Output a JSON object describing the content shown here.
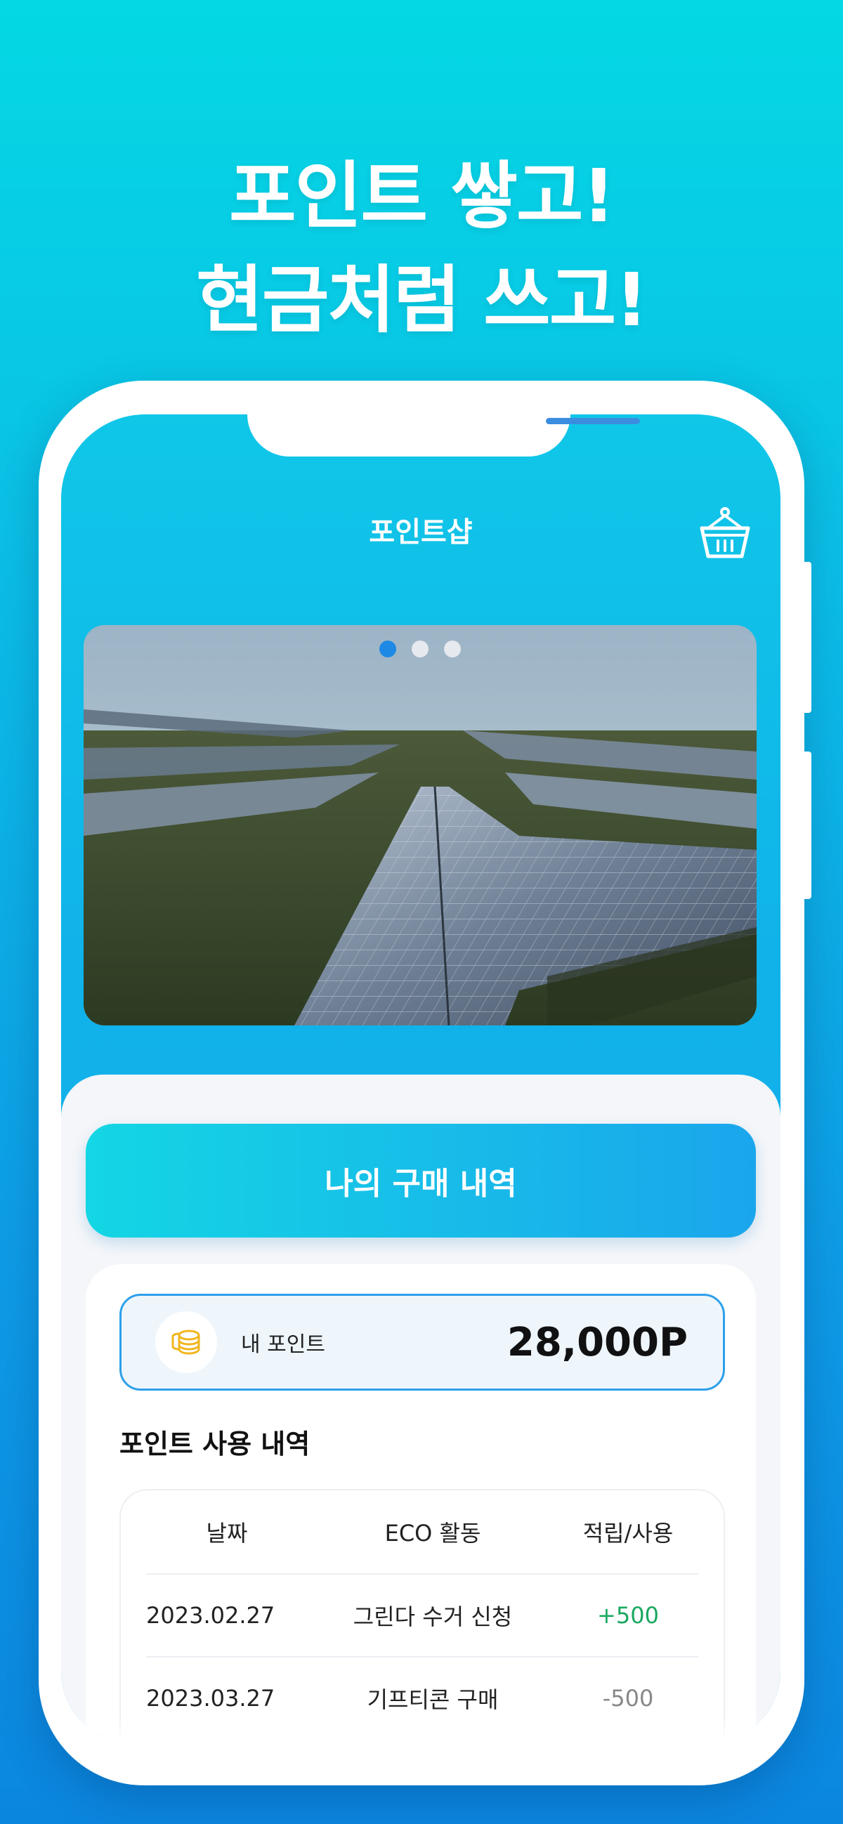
{
  "headline": {
    "line1": "포인트 쌓고!",
    "line2": "현금처럼 쓰고!"
  },
  "screen": {
    "title": "포인트샵",
    "cart_icon": "basket-icon"
  },
  "banner": {
    "slide_count": 3,
    "active_slide": 1,
    "image_subject": "solar panel farm"
  },
  "purchase_history_button": "나의 구매 내역",
  "points": {
    "icon": "coins-icon",
    "label": "내 포인트",
    "value": "28,000P"
  },
  "history": {
    "title": "포인트 사용 내역",
    "columns": [
      "날짜",
      "ECO 활동",
      "적립/사용"
    ],
    "rows": [
      {
        "date": "2023.02.27",
        "activity": "그린다 수거 신청",
        "amount": "+500"
      },
      {
        "date": "2023.03.27",
        "activity": "기프티콘 구매",
        "amount": "-500"
      }
    ]
  },
  "colors": {
    "accent": "#1aa6ec",
    "positive": "#1aa860",
    "negative": "#888888",
    "active_dot": "#1e88e5"
  }
}
